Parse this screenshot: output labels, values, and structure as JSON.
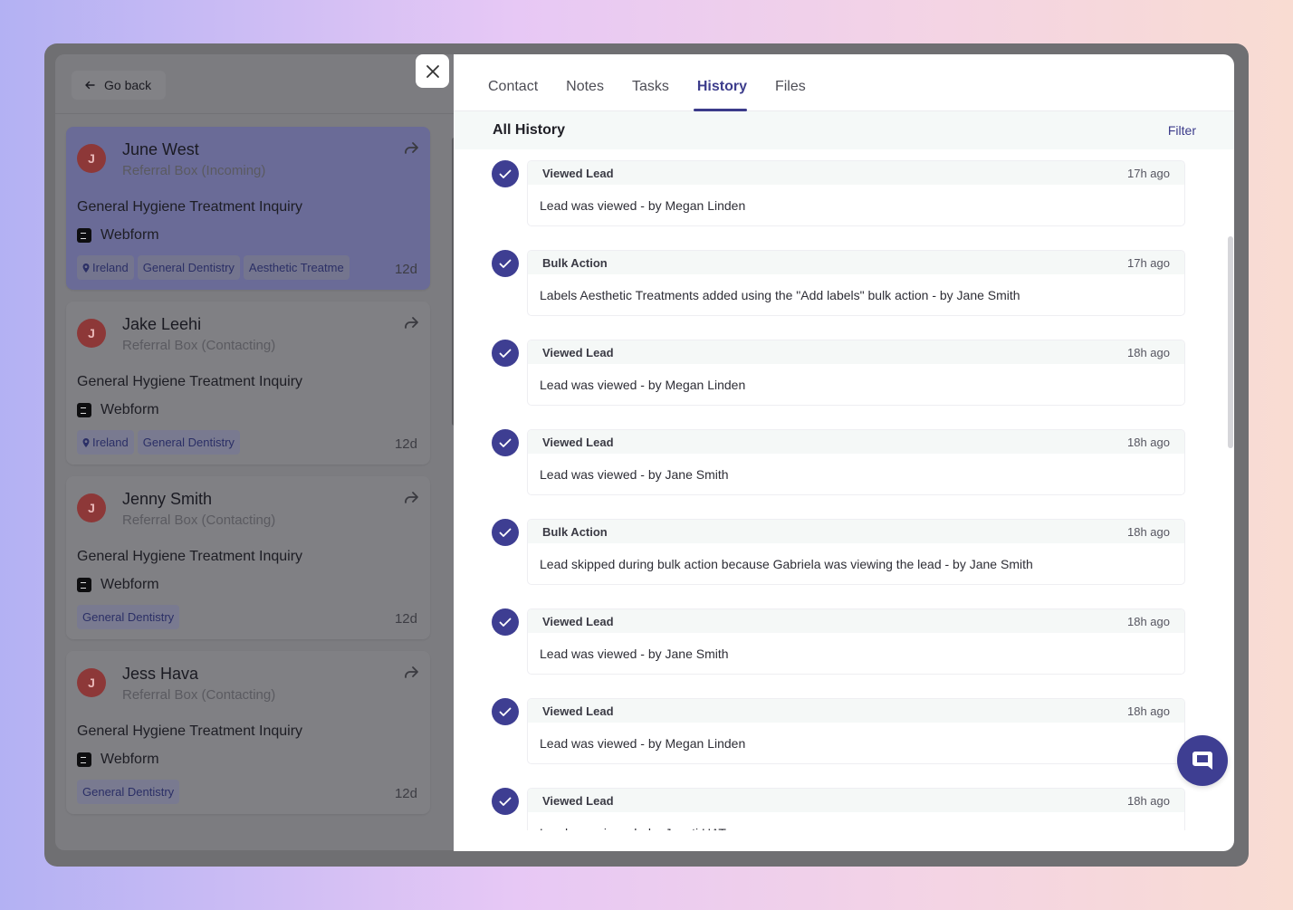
{
  "nav": {
    "go_back": "Go back"
  },
  "leads": [
    {
      "initial": "J",
      "name": "June West",
      "status": "Referral Box (Incoming)",
      "inquiry": "General Hygiene Treatment Inquiry",
      "source": "Webform",
      "tags": [
        "Ireland",
        "General Dentistry",
        "Aesthetic Treatme"
      ],
      "age": "12d",
      "active": true
    },
    {
      "initial": "J",
      "name": "Jake Leehi",
      "status": "Referral Box (Contacting)",
      "inquiry": "General Hygiene Treatment Inquiry",
      "source": "Webform",
      "tags": [
        "Ireland",
        "General Dentistry"
      ],
      "age": "12d",
      "active": false
    },
    {
      "initial": "J",
      "name": "Jenny Smith",
      "status": "Referral Box (Contacting)",
      "inquiry": "General Hygiene Treatment Inquiry",
      "source": "Webform",
      "tags": [
        "General Dentistry"
      ],
      "age": "12d",
      "active": false
    },
    {
      "initial": "J",
      "name": "Jess Hava",
      "status": "Referral Box (Contacting)",
      "inquiry": "General Hygiene Treatment Inquiry",
      "source": "Webform",
      "tags": [
        "General Dentistry"
      ],
      "age": "12d",
      "active": false
    }
  ],
  "tabs": [
    "Contact",
    "Notes",
    "Tasks",
    "History",
    "Files"
  ],
  "active_tab": "History",
  "history": {
    "title": "All History",
    "filter": "Filter",
    "entries": [
      {
        "type": "Viewed Lead",
        "time": "17h ago",
        "text": "Lead was viewed - by Megan Linden"
      },
      {
        "type": "Bulk Action",
        "time": "17h ago",
        "text": "Labels Aesthetic Treatments added using the \"Add labels\" bulk action - by  Jane Smith"
      },
      {
        "type": "Viewed Lead",
        "time": "18h ago",
        "text": "Lead was viewed - by Megan Linden"
      },
      {
        "type": "Viewed Lead",
        "time": "18h ago",
        "text": "Lead was viewed - by Jane Smith"
      },
      {
        "type": "Bulk Action",
        "time": "18h ago",
        "text": "Lead skipped during bulk action because  Gabriela  was viewing the lead - by Jane Smith"
      },
      {
        "type": "Viewed Lead",
        "time": "18h ago",
        "text": "Lead was viewed - by Jane Smith"
      },
      {
        "type": "Viewed Lead",
        "time": "18h ago",
        "text": "Lead was viewed - by Megan Linden"
      },
      {
        "type": "Viewed Lead",
        "time": "18h ago",
        "text": "Lead was viewed - by Jayati HAT"
      }
    ]
  },
  "colors": {
    "accent": "#3e3e92",
    "active_card": "#6a6b97",
    "avatar": "#8d3838"
  },
  "icons": {
    "back": "arrow-left-icon",
    "close": "close-icon",
    "share": "share-arrow-icon",
    "check": "check-icon",
    "chat": "chat-bubble-icon",
    "source": "form-icon",
    "location": "map-pin-icon"
  }
}
